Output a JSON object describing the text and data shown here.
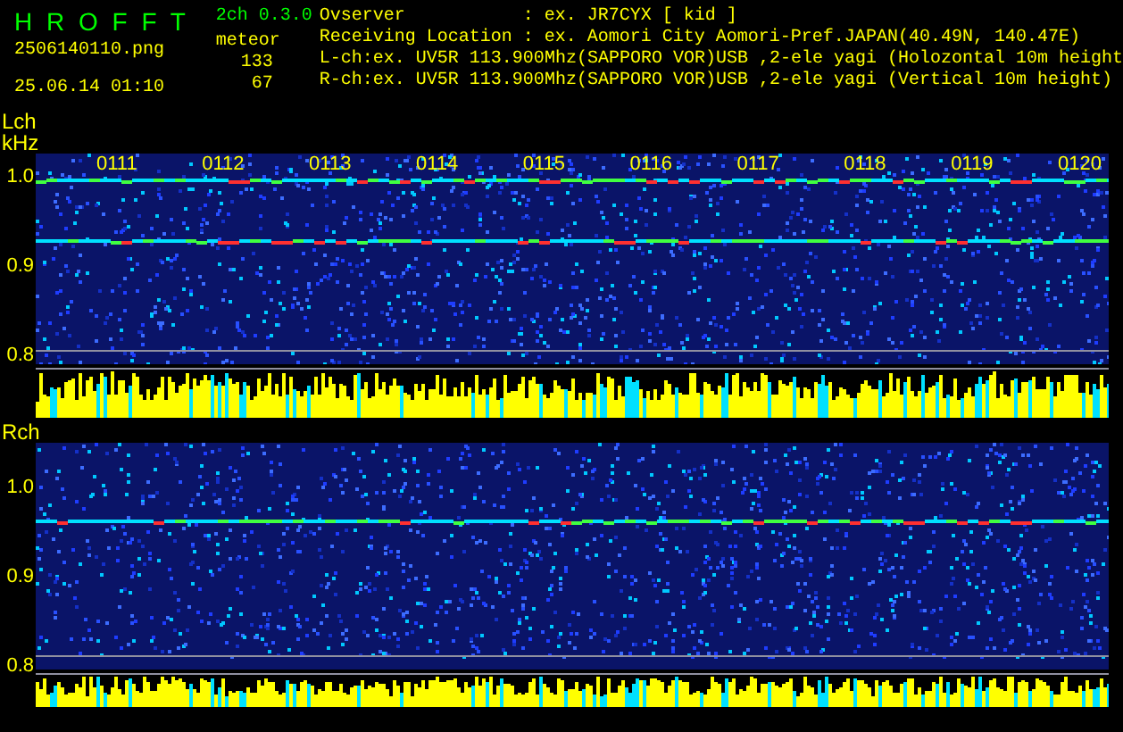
{
  "header": {
    "title": "H R O F F T",
    "version": "2ch 0.3.0",
    "filename": "2506140110.png",
    "datetime": "25.06.14 01:10",
    "count_label": "meteor",
    "counts": [
      "133",
      "67"
    ]
  },
  "info": [
    {
      "label": "Ovserver",
      "value": ": ex. JR7CYX [ kid ]"
    },
    {
      "label": "Receiving Location",
      "value": ": ex. Aomori City Aomori-Pref.JAPAN(40.49N, 140.47E)"
    },
    {
      "label": "L-ch:",
      "value": "ex. UV5R 113.900Mhz(SAPPORO VOR)USB ,2-ele yagi (Holozontal 10m height"
    },
    {
      "label": "R-ch:",
      "value": "ex. UV5R 113.900Mhz(SAPPORO VOR)USB ,2-ele yagi (Vertical 10m height)"
    }
  ],
  "panels": [
    {
      "label": "Lch",
      "unit": "kHz",
      "axis_labels": [
        "1.0",
        "0.9",
        "0.8"
      ],
      "time_labels": [
        "0111",
        "0112",
        "0113",
        "0114",
        "0115",
        "0116",
        "0117",
        "0118",
        "0119",
        "0120"
      ]
    },
    {
      "label": "Rch",
      "axis_labels": [
        "1.0",
        "0.9",
        "0.8"
      ]
    }
  ]
}
